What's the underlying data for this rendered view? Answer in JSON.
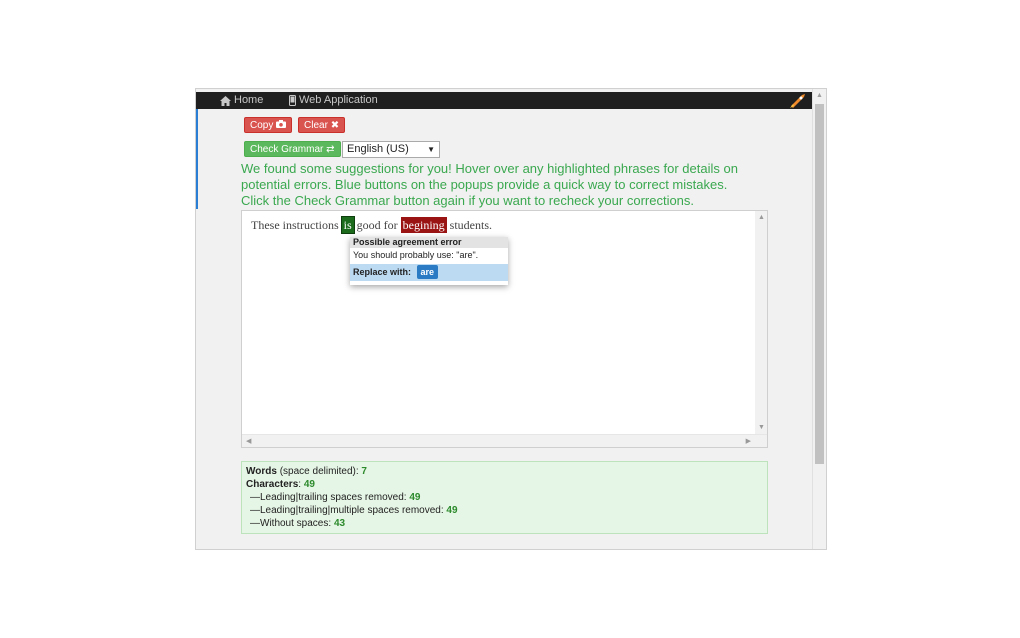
{
  "nav": {
    "items": [
      {
        "label": "Home",
        "icon": "home-icon"
      },
      {
        "label": "Web Application",
        "icon": "mobile-icon"
      }
    ],
    "logo_icon": "rocket-icon"
  },
  "toolbar": {
    "copy_label": "Copy",
    "copy_icon": "camera-icon",
    "clear_label": "Clear",
    "clear_icon": "close-icon",
    "check_label": "Check Grammar",
    "check_icon": "swap-icon",
    "language": "English (US)"
  },
  "message": {
    "lines": [
      "We found some suggestions for you! Hover over any highlighted phrases for details on",
      "potential errors. Blue buttons on the popups provide a quick way to correct mistakes.",
      "Click the Check Grammar button again if you want to recheck your corrections."
    ]
  },
  "editor": {
    "text_before": "These instructions",
    "highlight_agreement": "is",
    "text_middle": "good for",
    "highlight_spelling": "begining",
    "text_after": "students."
  },
  "popup": {
    "title": "Possible agreement error",
    "body": "You should probably use: \"are\".",
    "replace_label": "Replace with:",
    "replace_value": "are"
  },
  "stats": {
    "words_label": "Words",
    "words_note": "(space delimited):",
    "words": "7",
    "chars_label": "Characters",
    "chars": "49",
    "trim_label": "—Leading|trailing spaces removed:",
    "trim": "49",
    "multi_label": "—Leading|trailing|multiple spaces removed:",
    "multi": "49",
    "nospace_label": "—Without spaces:",
    "nospace": "43"
  },
  "colors": {
    "accent_green": "#3aa84f",
    "error_red": "#9a1414",
    "agreement_green": "#1c6b1c",
    "replace_blue": "#2b7bc4"
  }
}
